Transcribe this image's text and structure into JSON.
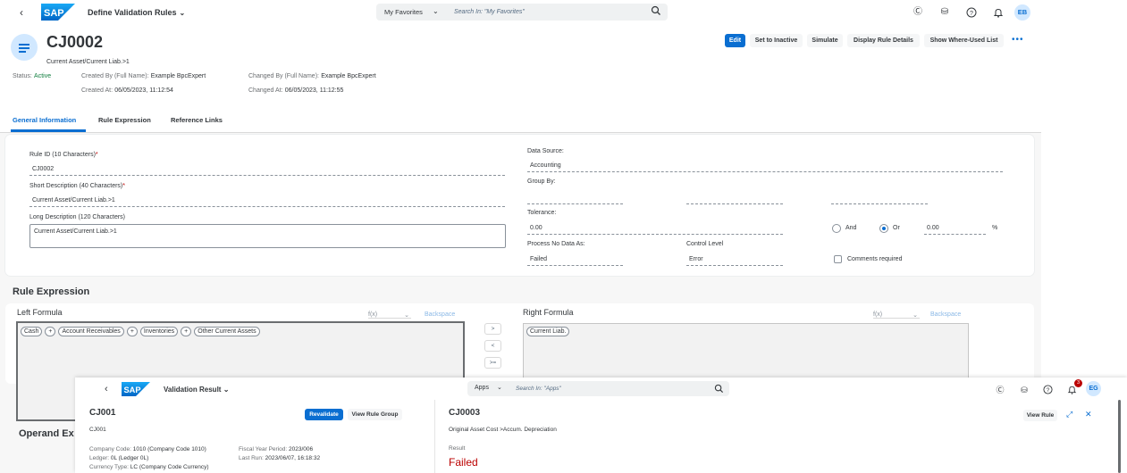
{
  "shell": {
    "app_title": "Define Validation Rules",
    "search_scope": "My Favorites",
    "search_placeholder": "Search In: \"My Favorites\"",
    "avatar": "EB"
  },
  "object": {
    "id": "CJ0002",
    "subtitle": "Current Asset/Current Liab.>1",
    "status_label": "Status:",
    "status_value": "Active",
    "created_by_label": "Created By (Full Name):",
    "created_by_value": "Example BpcExpert",
    "created_at_label": "Created At:",
    "created_at_value": "06/05/2023, 11:12:54",
    "changed_by_label": "Changed By (Full Name):",
    "changed_by_value": "Example BpcExpert",
    "changed_at_label": "Changed At:",
    "changed_at_value": "06/05/2023, 11:12:55"
  },
  "actions": {
    "edit": "Edit",
    "set_inactive": "Set to Inactive",
    "simulate": "Simulate",
    "display_details": "Display Rule Details",
    "where_used": "Show Where-Used List",
    "more": "•••"
  },
  "tabs": [
    "General Information",
    "Rule Expression",
    "Reference Links"
  ],
  "general": {
    "rule_id_label": "Rule ID (10 Characters)",
    "rule_id_value": "CJ0002",
    "short_desc_label": "Short Description (40 Characters)",
    "short_desc_value": "Current Asset/Current Liab.>1",
    "long_desc_label": "Long Description (120 Characters)",
    "long_desc_value": "Current Asset/Current Liab.>1",
    "data_source_label": "Data Source:",
    "data_source_value": "Accounting",
    "group_by_label": "Group By:",
    "tolerance_label": "Tolerance:",
    "tolerance_value": "0.00",
    "and_label": "And",
    "or_label": "Or",
    "tolerance_pct_value": "0.00",
    "pct": "%",
    "process_label": "Process No Data As:",
    "process_value": "Failed",
    "control_label": "Control Level",
    "control_value": "Error",
    "comments_label": "Comments required"
  },
  "rule_expression": {
    "title": "Rule Expression",
    "left_label": "Left Formula",
    "right_label": "Right Formula",
    "fx": "f(x)",
    "backspace": "Backspace",
    "left_tokens": [
      "Cash",
      "+",
      "Account Receivables",
      "+",
      "Inventories",
      "+",
      "Other Current Assets"
    ],
    "right_tokens": [
      "Current Liab."
    ],
    "operators": [
      ">",
      "<",
      ">="
    ],
    "operand_title": "Operand Ex"
  },
  "overlay": {
    "app_title": "Validation Result",
    "search_scope": "Apps",
    "search_placeholder": "Search In: \"Apps\"",
    "notification_count": "3",
    "avatar": "EG",
    "left_title": "CJ001",
    "left_sub": "CJ001",
    "revalidate": "Revalidate",
    "view_rule_group": "View Rule Group",
    "company_code_label": "Company Code:",
    "company_code_value": "1010 (Company Code 1010)",
    "ledger_label": "Ledger:",
    "ledger_value": "0L (Ledger 0L)",
    "currency_label": "Currency Type:",
    "currency_value": "LC (Company Code Currency)",
    "fiscal_label": "Fiscal Year Period:",
    "fiscal_value": "2023/006",
    "last_run_label": "Last Run:",
    "last_run_value": "2023/06/07, 16:18:32",
    "right_title": "CJ0003",
    "right_sub": "Original Asset Cost >Accum. Depreciation",
    "view_rule": "View Rule",
    "result_label": "Result",
    "result_value": "Failed"
  },
  "colors": {
    "accent": "#0a6ed1",
    "positive": "#107e3e",
    "negative": "#bb0000"
  }
}
